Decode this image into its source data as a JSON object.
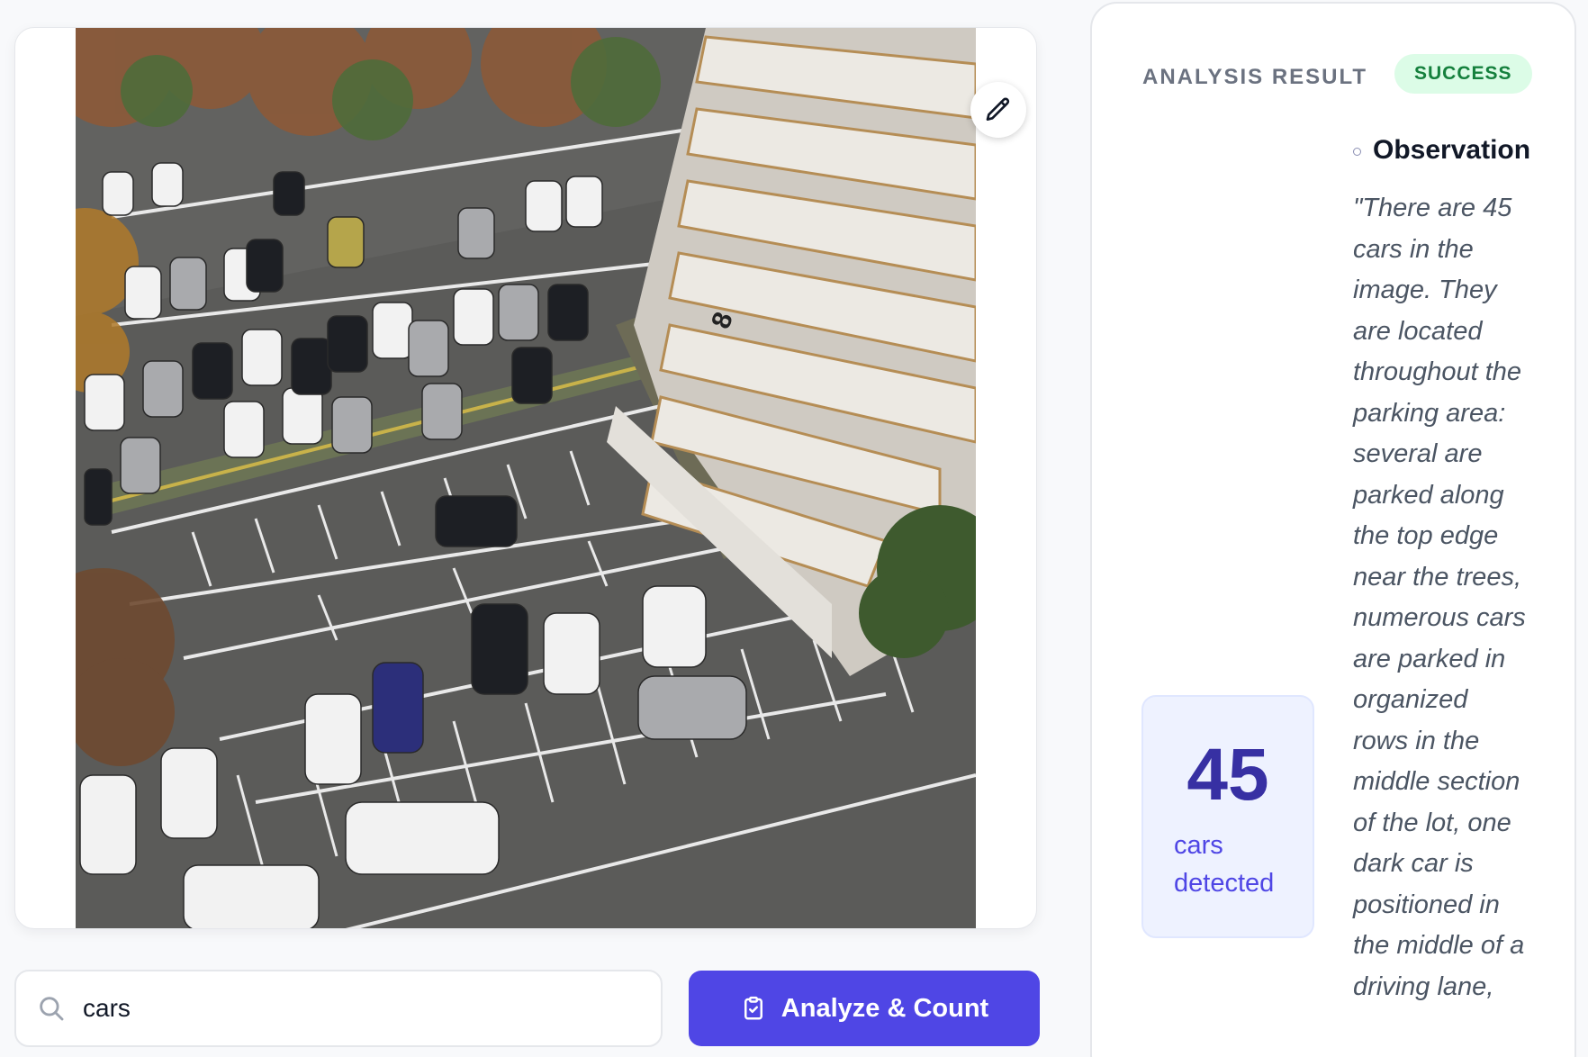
{
  "query": {
    "value": "cars",
    "placeholder": ""
  },
  "actions": {
    "analyze_label": "Analyze & Count"
  },
  "result": {
    "title": "ANALYSIS RESULT",
    "status": "SUCCESS",
    "count": "45",
    "count_label": "cars detected",
    "observation_title": "Observation",
    "observation_text": "\"There are 45 cars in the image. They are located throughout the parking area: several are parked along the top edge near the trees, numerous cars are parked in organized rows in the middle section of the lot, one dark car is positioned in the middle of a driving lane,"
  },
  "image": {
    "building_number": "8"
  },
  "colors": {
    "accent": "#4f46e5",
    "accent_dark": "#3730a3",
    "success_bg": "#dcfce7",
    "success_text": "#15803d",
    "count_card_bg": "#eef2ff"
  },
  "icons": {
    "edit": "pencil-icon",
    "search": "search-icon",
    "analyze": "clipboard-check-icon"
  }
}
